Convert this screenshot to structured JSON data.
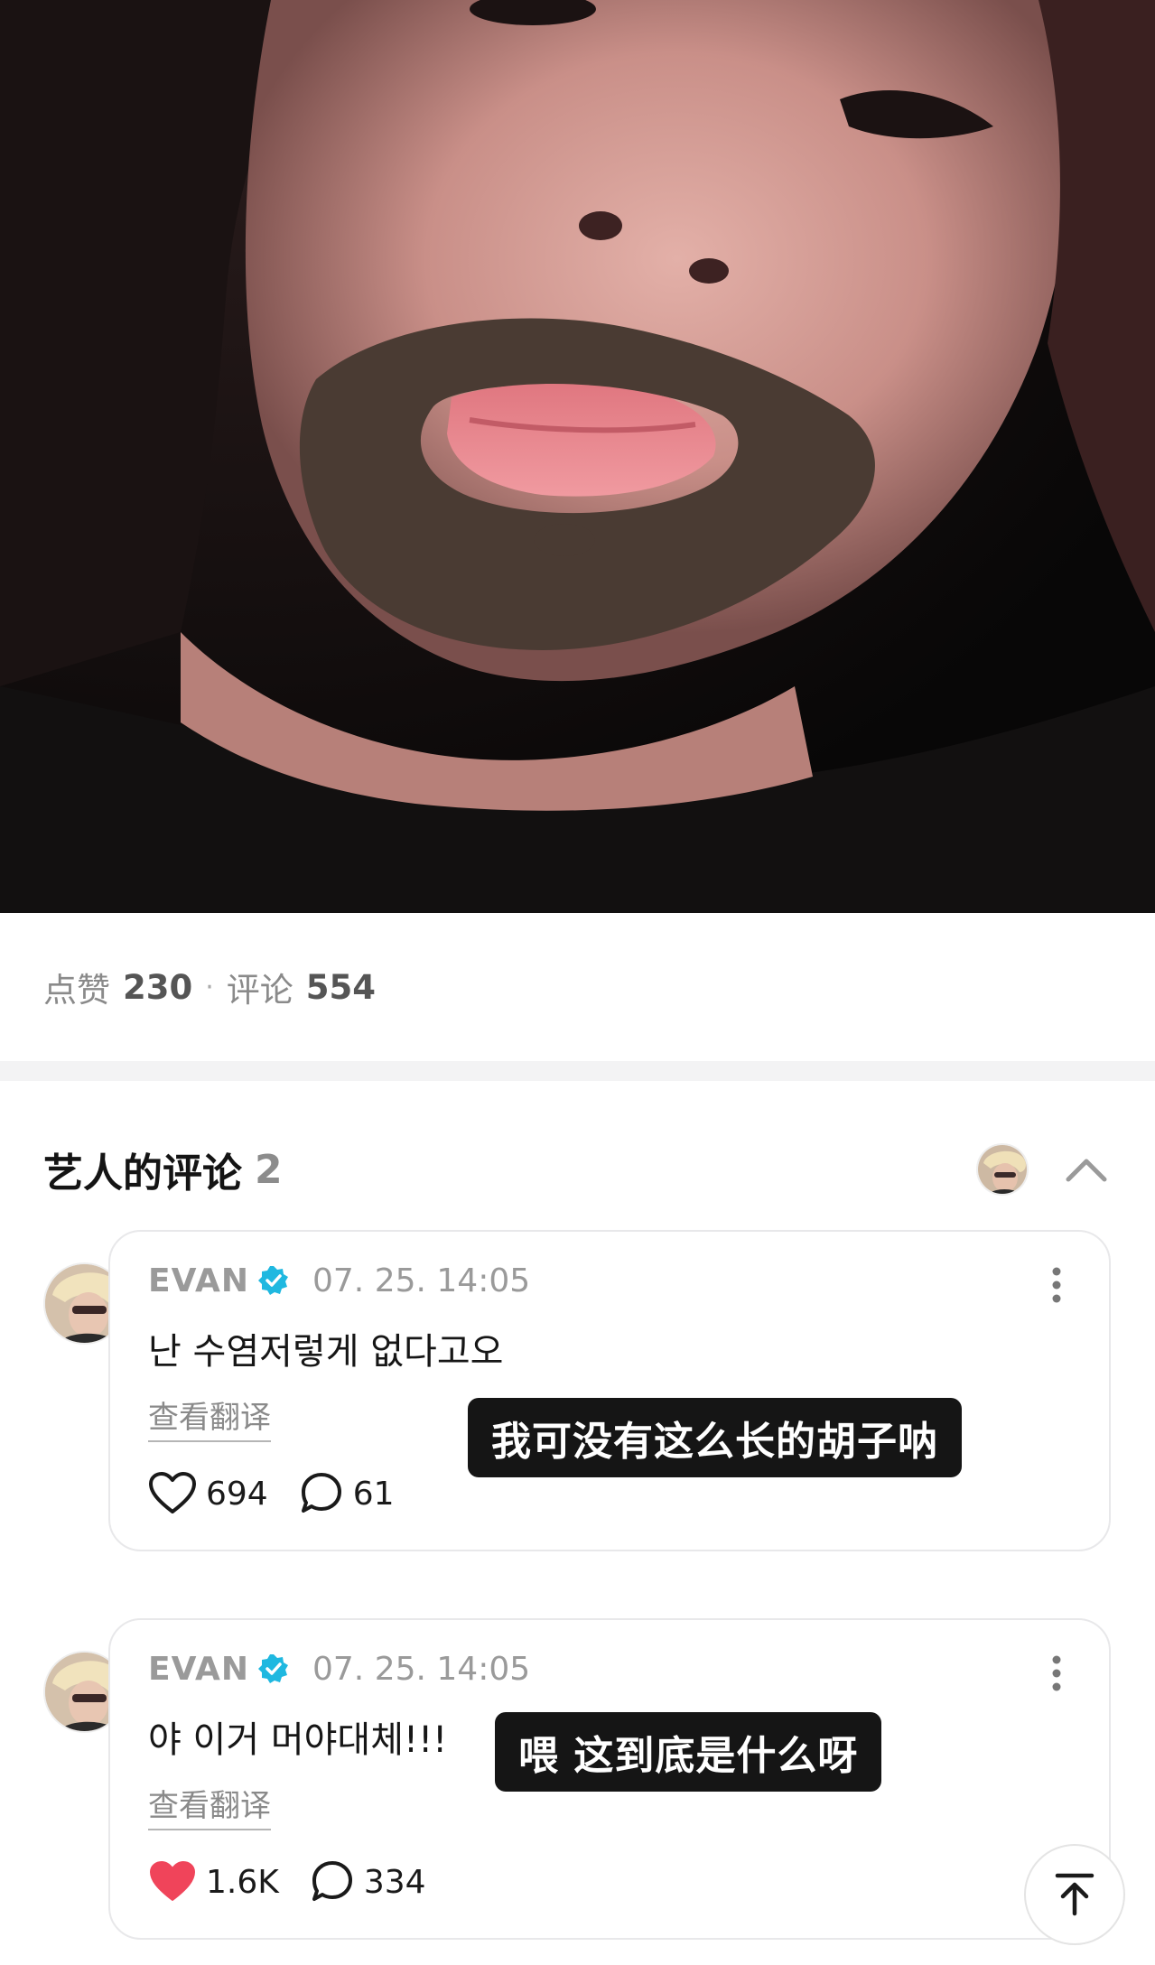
{
  "post": {
    "image_description_icon": "photo-bearded-face"
  },
  "stats": {
    "likes_label": "点赞",
    "likes_count": "230",
    "separator": "·",
    "comments_label": "评论",
    "comments_count": "554"
  },
  "artist_comments": {
    "title": "艺人的评论",
    "count": "2",
    "collapse_icon": "chevron-up-icon"
  },
  "comments": [
    {
      "author": "EVAN",
      "verified": true,
      "time": "07. 25. 14:05",
      "text": "난 수염저렇게 없다고오",
      "translate_label": "查看翻译",
      "likes": "694",
      "liked": false,
      "replies": "61",
      "subtitle": "我可没有这么长的胡子呐"
    },
    {
      "author": "EVAN",
      "verified": true,
      "time": "07. 25. 14:05",
      "text": "야 이거 머야대체!!!",
      "translate_label": "查看翻译",
      "likes": "1.6K",
      "liked": true,
      "replies": "334",
      "subtitle": "喂 这到底是什么呀"
    }
  ],
  "colors": {
    "verified": "#1fb8e0",
    "liked_heart": "#f0445a",
    "subtitle_bg": "#151515"
  },
  "scroll_top_icon": "arrow-up-to-top-icon"
}
